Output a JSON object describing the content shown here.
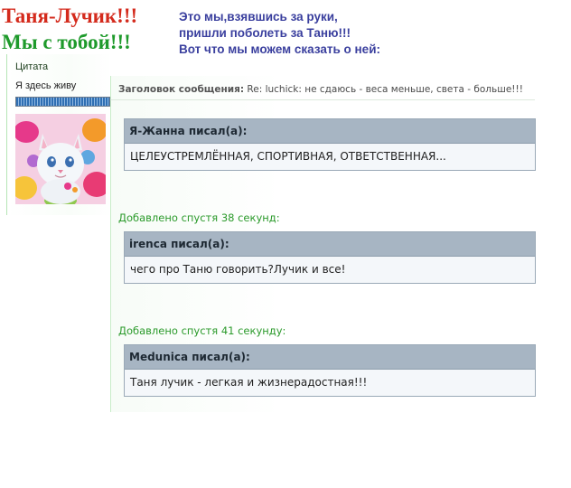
{
  "header": {
    "title_line1": "Таня-Лучик!!!",
    "title_line2": "Мы с тобой!!!",
    "tagline_line1": "Это мы,взявшись за руки,",
    "tagline_line2": "пришли поболеть за Таню!!!",
    "tagline_line3": "Вот что мы можем сказать о ней:"
  },
  "sidebar": {
    "rank": "Цитата",
    "status": "Я здесь живу",
    "rank_progress": 1.0,
    "avatar_icon": "kitten-avatar"
  },
  "post": {
    "subject_label": "Заголовок сообщения:",
    "subject_text": "Re: luchick: не сдаюсь - веса меньше, света - больше!!!",
    "quotes": [
      {
        "header": "Я-Жанна писал(а):",
        "body": "ЦЕЛЕУСТРЕМЛЁННАЯ, СПОРТИВНАЯ, ОТВЕТСТВЕННАЯ..."
      },
      {
        "added": "Добавлено спустя 38 секунд:",
        "header": "irenca писал(а):",
        "body": "чего про Таню говорить?Лучик и все!"
      },
      {
        "added": "Добавлено спустя 41 секунду:",
        "header": "Medunica писал(а):",
        "body": "Таня лучик - легкая и жизнерадостная!!!"
      }
    ]
  },
  "colors": {
    "title_red": "#d42a1c",
    "title_green": "#1e9a2b",
    "tagline": "#3a3f9e",
    "added_green": "#2b9a2b",
    "quote_header": "#a7b5c3"
  }
}
